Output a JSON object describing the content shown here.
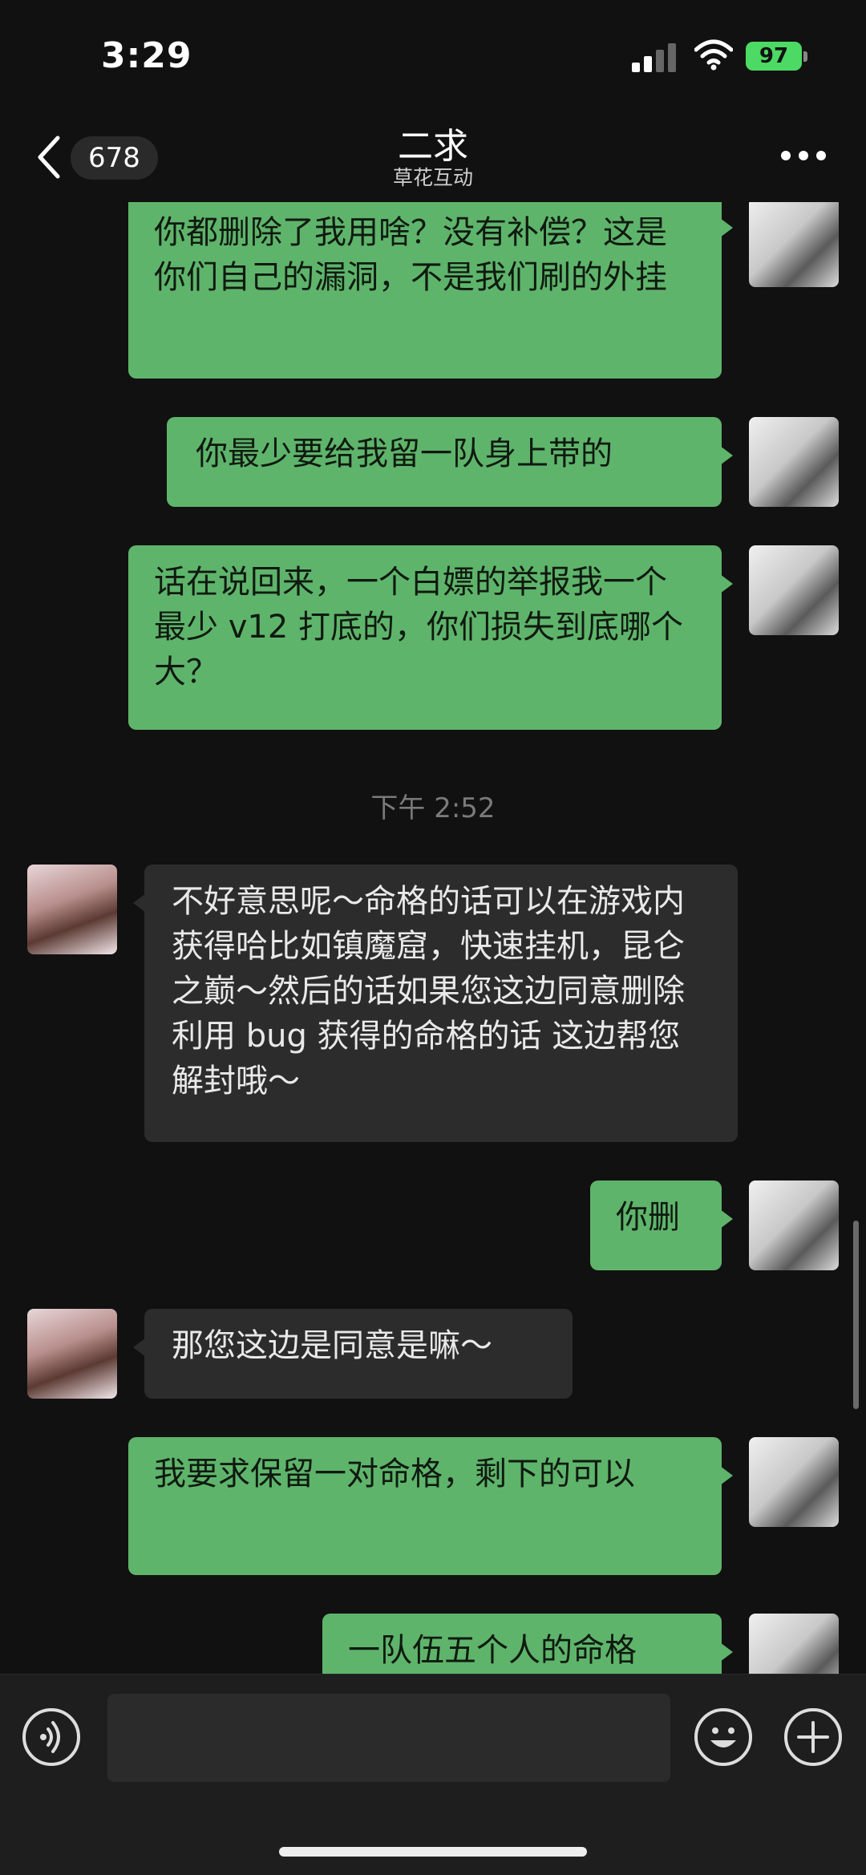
{
  "status_bar": {
    "time": "3:29",
    "battery": "97"
  },
  "header": {
    "unread_count": "678",
    "title": "二求",
    "subtitle": "草花互动"
  },
  "messages": [
    {
      "sender": "me",
      "text": "你都删除了我用啥？没有补偿？这是你们自己的漏洞，不是我们刷的外挂"
    },
    {
      "sender": "me",
      "text": "你最少要给我留一队身上带的"
    },
    {
      "sender": "me",
      "text": "话在说回来，一个白嫖的举报我一个最少 v12 打底的，你们损失到底哪个大？"
    },
    {
      "timestamp": "下午 2:52"
    },
    {
      "sender": "them",
      "text": "不好意思呢～命格的话可以在游戏内获得哈比如镇魔窟，快速挂机，昆仑之巅～然后的话如果您这边同意删除利用 bug 获得的命格的话 这边帮您解封哦～"
    },
    {
      "sender": "me",
      "text": "你删"
    },
    {
      "sender": "them",
      "text": "那您这边是同意是嘛～"
    },
    {
      "sender": "me",
      "text": "我要求保留一对命格，剩下的可以"
    },
    {
      "sender": "me",
      "text": "一队伍五个人的命格"
    }
  ],
  "icons": {
    "back": "chevron-left-icon",
    "more": "more-dots-icon",
    "voice": "voice-icon",
    "emoji": "emoji-icon",
    "plus": "plus-icon"
  },
  "colors": {
    "my_bubble": "#5fb46b",
    "their_bubble": "#2c2c2c",
    "background": "#111111"
  }
}
